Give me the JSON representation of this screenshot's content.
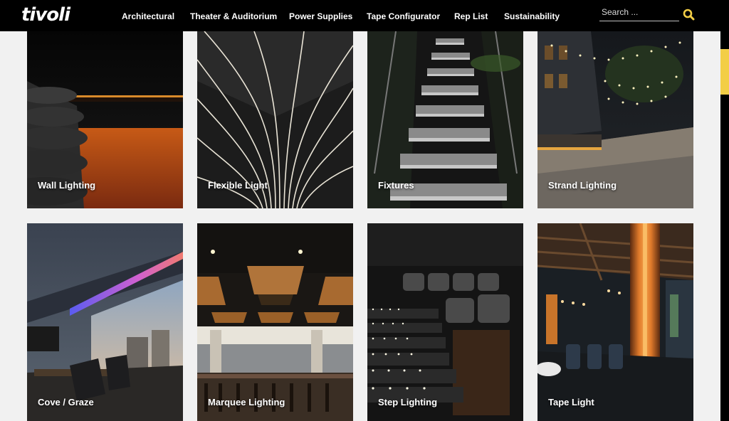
{
  "header": {
    "logo_text": "tivoli",
    "nav": [
      "Architectural",
      "Theater & Auditorium",
      "Power Supplies",
      "Tape Configurator",
      "Rep List",
      "Sustainability"
    ],
    "search": {
      "placeholder": "Search ...",
      "value": "",
      "icon": "search-icon"
    },
    "accent_color": "#f3ce46"
  },
  "tiles": [
    {
      "label": "Wall Lighting"
    },
    {
      "label": "Flexible Light"
    },
    {
      "label": "Fixtures"
    },
    {
      "label": "Strand Lighting"
    },
    {
      "label": "Cove / Graze"
    },
    {
      "label": "Marquee Lighting"
    },
    {
      "label": "Step Lighting"
    },
    {
      "label": "Tape Light"
    }
  ]
}
